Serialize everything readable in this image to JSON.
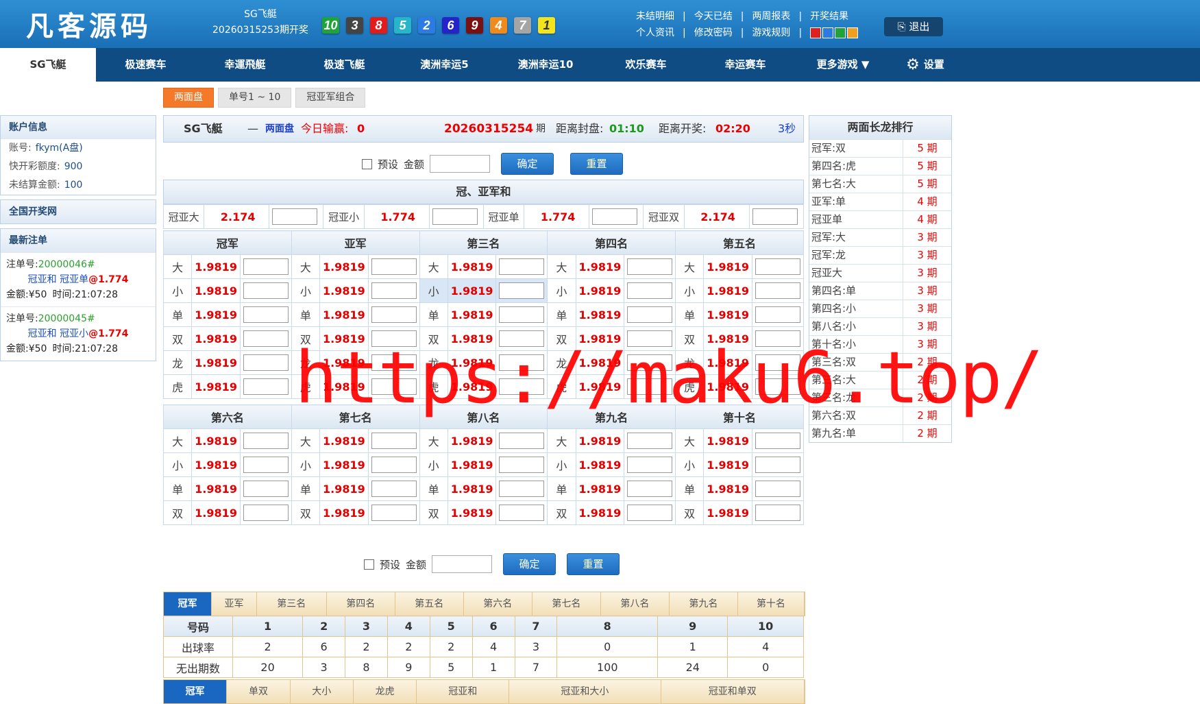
{
  "header": {
    "logo": "凡客源码",
    "game_name": "SG飞艇",
    "draw_period": "20260315253期开奖",
    "balls": [
      {
        "n": "10",
        "color": "#1fa33a"
      },
      {
        "n": "3",
        "color": "#444444"
      },
      {
        "n": "8",
        "color": "#e21b1b"
      },
      {
        "n": "5",
        "color": "#27b5c9"
      },
      {
        "n": "2",
        "color": "#2b7be3"
      },
      {
        "n": "6",
        "color": "#2424c8"
      },
      {
        "n": "9",
        "color": "#7a1010"
      },
      {
        "n": "4",
        "color": "#f08a1c"
      },
      {
        "n": "7",
        "color": "#a5a5a5"
      },
      {
        "n": "1",
        "color": "#f2e51e"
      }
    ],
    "links_row1": [
      "未结明细",
      "今天已结",
      "两周报表",
      "开奖结果"
    ],
    "links_row2": [
      "个人资讯",
      "修改密码",
      "游戏规则"
    ],
    "theme_swatches": [
      "#e02020",
      "#2b7be3",
      "#1fa33a",
      "#f0a020"
    ],
    "logout": "退出"
  },
  "nav": {
    "items": [
      "SG飞艇",
      "极速赛车",
      "幸運飛艇",
      "极速飞艇",
      "澳洲幸运5",
      "澳洲幸运10",
      "欢乐赛车",
      "幸运赛车",
      "更多游戏 ▼"
    ],
    "settings": "设置"
  },
  "subtabs": [
    "两面盘",
    "单号1 ~ 10",
    "冠亚军组合"
  ],
  "account": {
    "title": "账户信息",
    "rows": [
      {
        "label": "账号:",
        "value": "fkym(A盘)"
      },
      {
        "label": "快开彩额度:",
        "value": "900"
      },
      {
        "label": "未结算金额:",
        "value": "100"
      }
    ],
    "national": "全国开奖网",
    "latest_title": "最新注单",
    "orders": [
      {
        "label": "注单号:",
        "num": "20000046#",
        "bet": "冠亚和 冠亚单",
        "odd": "@1.774",
        "amount": "金额:¥50",
        "time": "时间:21:07:28"
      },
      {
        "label": "注单号:",
        "num": "20000045#",
        "bet": "冠亚和 冠亚小",
        "odd": "@1.774",
        "amount": "金额:¥50",
        "time": "时间:21:07:28"
      }
    ]
  },
  "main": {
    "game": "SG飞艇",
    "dash": "—",
    "mode": "两面盘",
    "today_label": "今日输赢:",
    "today_value": "0",
    "period": "20260315254",
    "period_suffix": "期",
    "close_label": "距离封盘:",
    "close_time": "01:10",
    "open_label": "距离开奖:",
    "open_time": "02:20",
    "refresh": "3秒",
    "preset": "预设",
    "amount": "金额",
    "confirm": "确定",
    "reset": "重置",
    "guanya_title": "冠、亚军和",
    "guanya": [
      {
        "label": "冠亚大",
        "odds": "2.174"
      },
      {
        "label": "冠亚小",
        "odds": "1.774"
      },
      {
        "label": "冠亚单",
        "odds": "1.774"
      },
      {
        "label": "冠亚双",
        "odds": "2.174"
      }
    ],
    "top_positions": [
      "冠军",
      "亚军",
      "第三名",
      "第四名",
      "第五名"
    ],
    "top_rows": [
      "大",
      "小",
      "单",
      "双",
      "龙",
      "虎"
    ],
    "bottom_positions": [
      "第六名",
      "第七名",
      "第八名",
      "第九名",
      "第十名"
    ],
    "bottom_rows": [
      "大",
      "小",
      "单",
      "双"
    ],
    "odds": "1.9819"
  },
  "ranking": {
    "title": "两面长龙排行",
    "rows": [
      {
        "name": "冠军:双",
        "count": "5 期"
      },
      {
        "name": "第四名:虎",
        "count": "5 期"
      },
      {
        "name": "第七名:大",
        "count": "5 期"
      },
      {
        "name": "亚军:单",
        "count": "4 期"
      },
      {
        "name": "冠亚单",
        "count": "4 期"
      },
      {
        "name": "冠军:大",
        "count": "3 期"
      },
      {
        "name": "冠军:龙",
        "count": "3 期"
      },
      {
        "name": "冠亚大",
        "count": "3 期"
      },
      {
        "name": "第四名:单",
        "count": "3 期"
      },
      {
        "name": "第四名:小",
        "count": "3 期"
      },
      {
        "name": "第八名:小",
        "count": "3 期"
      },
      {
        "name": "第十名:小",
        "count": "3 期"
      },
      {
        "name": "第三名:双",
        "count": "2 期"
      },
      {
        "name": "第三名:大",
        "count": "2 期"
      },
      {
        "name": "第三名:龙",
        "count": "2 期"
      },
      {
        "name": "第六名:双",
        "count": "2 期"
      },
      {
        "name": "第九名:单",
        "count": "2 期"
      }
    ]
  },
  "stats": {
    "tabs": [
      "冠军",
      "亚军",
      "第三名",
      "第四名",
      "第五名",
      "第六名",
      "第七名",
      "第八名",
      "第九名",
      "第十名"
    ],
    "head_label": "号码",
    "numbers": [
      "1",
      "2",
      "3",
      "4",
      "5",
      "6",
      "7",
      "8",
      "9",
      "10"
    ],
    "rate_label": "出球率",
    "rates": [
      "2",
      "6",
      "2",
      "2",
      "2",
      "4",
      "3",
      "0",
      "1",
      "4"
    ],
    "miss_label": "无出期数",
    "misses": [
      "20",
      "3",
      "8",
      "9",
      "5",
      "1",
      "7",
      "100",
      "24",
      "0"
    ],
    "tabs2": [
      "冠军",
      "单双",
      "大小",
      "龙虎",
      "冠亚和",
      "冠亚和大小",
      "冠亚和单双"
    ]
  },
  "watermark": "https://maku6.top/"
}
